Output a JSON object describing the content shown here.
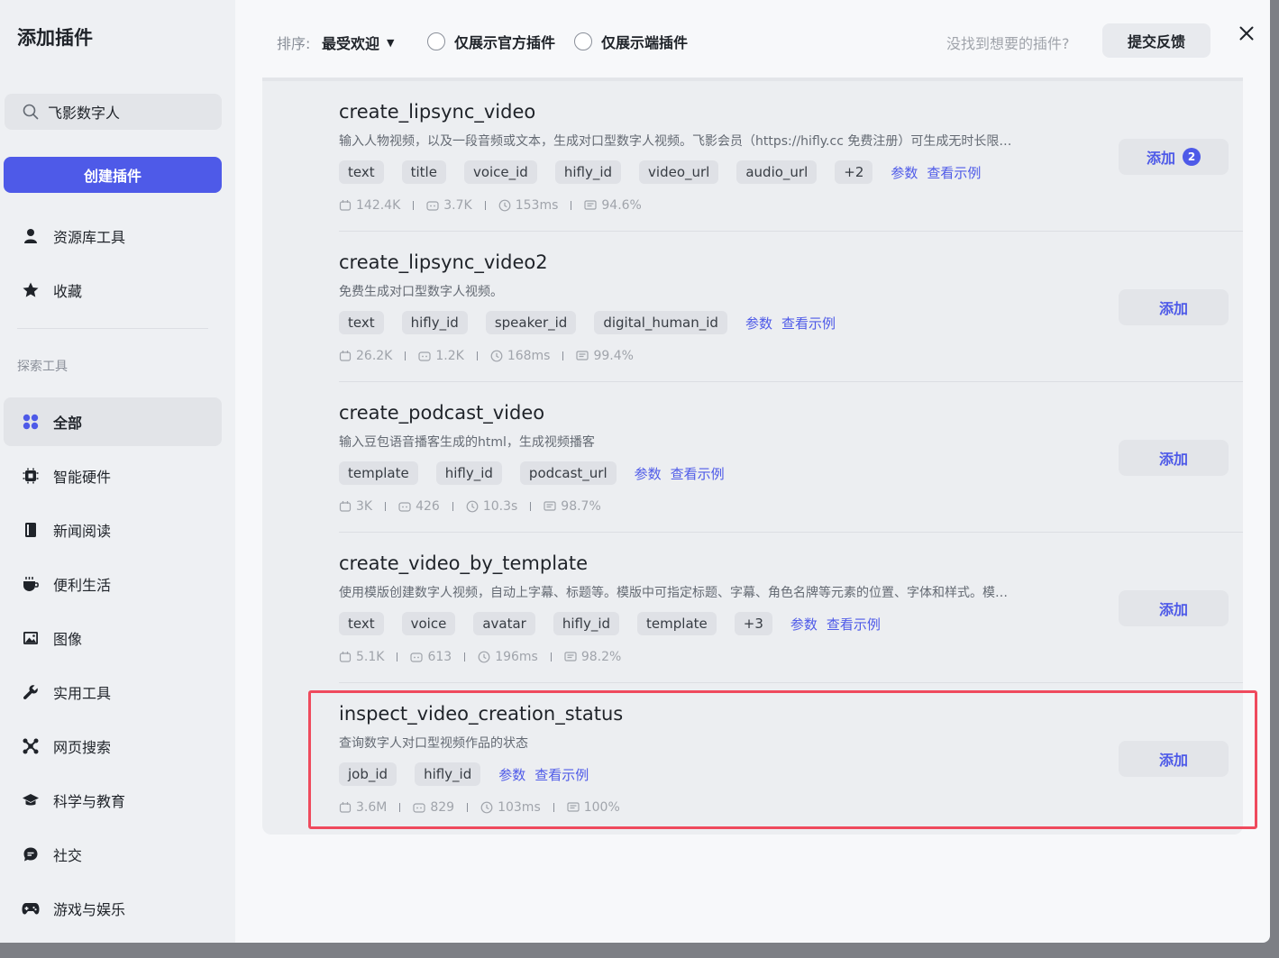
{
  "sidebar": {
    "title": "添加插件",
    "search_value": "飞影数字人",
    "create_button": "创建插件",
    "top_items": [
      {
        "label": "资源库工具",
        "icon": "person-icon"
      },
      {
        "label": "收藏",
        "icon": "star-icon"
      }
    ],
    "section_label": "探索工具",
    "categories": [
      {
        "label": "全部",
        "icon": "grid-icon",
        "active": true
      },
      {
        "label": "智能硬件",
        "icon": "chip-icon"
      },
      {
        "label": "新闻阅读",
        "icon": "book-icon"
      },
      {
        "label": "便利生活",
        "icon": "cup-icon"
      },
      {
        "label": "图像",
        "icon": "image-icon"
      },
      {
        "label": "实用工具",
        "icon": "wrench-icon"
      },
      {
        "label": "网页搜索",
        "icon": "network-icon"
      },
      {
        "label": "科学与教育",
        "icon": "graduation-cap-icon"
      },
      {
        "label": "社交",
        "icon": "chat-icon"
      },
      {
        "label": "游戏与娱乐",
        "icon": "gamepad-icon"
      }
    ]
  },
  "header": {
    "sort_label": "排序:",
    "sort_value": "最受欢迎",
    "filter_official": "仅展示官方插件",
    "filter_client": "仅展示端插件",
    "hint": "没找到想要的插件?",
    "feedback_button": "提交反馈"
  },
  "plugins": [
    {
      "name": "create_lipsync_video",
      "description": "输入人物视频，以及一段音频或文本，生成对口型数字人视频。飞影会员（https://hifly.cc 免费注册）可生成无时长限…",
      "tags": [
        "text",
        "title",
        "voice_id",
        "hifly_id",
        "video_url",
        "audio_url",
        "+2"
      ],
      "params_link": "参数",
      "example_link": "查看示例",
      "stats": {
        "calls": "142.4K",
        "bots": "3.7K",
        "latency": "153ms",
        "success": "94.6%"
      },
      "add_label": "添加",
      "badge": "2"
    },
    {
      "name": "create_lipsync_video2",
      "description": "免费生成对口型数字人视频。",
      "tags": [
        "text",
        "hifly_id",
        "speaker_id",
        "digital_human_id"
      ],
      "params_link": "参数",
      "example_link": "查看示例",
      "stats": {
        "calls": "26.2K",
        "bots": "1.2K",
        "latency": "168ms",
        "success": "99.4%"
      },
      "add_label": "添加"
    },
    {
      "name": "create_podcast_video",
      "description": "输入豆包语音播客生成的html，生成视频播客",
      "tags": [
        "template",
        "hifly_id",
        "podcast_url"
      ],
      "params_link": "参数",
      "example_link": "查看示例",
      "stats": {
        "calls": "3K",
        "bots": "426",
        "latency": "10.3s",
        "success": "98.7%"
      },
      "add_label": "添加"
    },
    {
      "name": "create_video_by_template",
      "description": "使用模版创建数字人视频，自动上字幕、标题等。模版中可指定标题、字幕、角色名牌等元素的位置、字体和样式。模…",
      "tags": [
        "text",
        "voice",
        "avatar",
        "hifly_id",
        "template",
        "+3"
      ],
      "params_link": "参数",
      "example_link": "查看示例",
      "stats": {
        "calls": "5.1K",
        "bots": "613",
        "latency": "196ms",
        "success": "98.2%"
      },
      "add_label": "添加"
    },
    {
      "name": "inspect_video_creation_status",
      "description": "查询数字人对口型视频作品的状态",
      "tags": [
        "job_id",
        "hifly_id"
      ],
      "params_link": "参数",
      "example_link": "查看示例",
      "stats": {
        "calls": "3.6M",
        "bots": "829",
        "latency": "103ms",
        "success": "100%"
      },
      "add_label": "添加"
    }
  ],
  "colors": {
    "accent": "#4e5ae8",
    "highlight": "#ef4a5d"
  }
}
